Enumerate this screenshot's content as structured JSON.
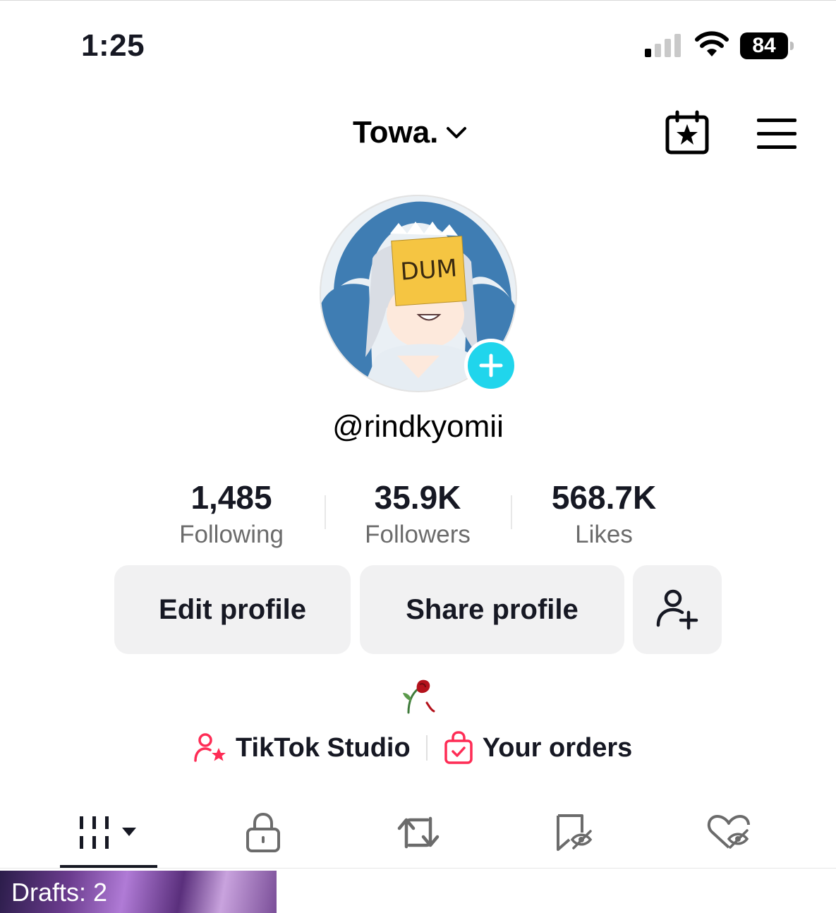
{
  "status_bar": {
    "time": "1:25",
    "battery": "84",
    "signal_icon": "cellular-signal-icon",
    "wifi_icon": "wifi-icon"
  },
  "header": {
    "account_name": "Towa.",
    "switch_icon": "chevron-down-icon",
    "calendar_icon": "calendar-star-icon",
    "menu_icon": "hamburger-menu-icon"
  },
  "profile": {
    "avatar_label": "DUM",
    "username": "@rindkyomii",
    "stats": [
      {
        "value": "1,485",
        "label": "Following"
      },
      {
        "value": "35.9K",
        "label": "Followers"
      },
      {
        "value": "568.7K",
        "label": "Likes"
      }
    ],
    "bio": "🥀"
  },
  "actions": {
    "edit_profile": "Edit profile",
    "share_profile": "Share profile",
    "add_friend_icon": "add-user-icon"
  },
  "links": {
    "studio": "TikTok Studio",
    "orders": "Your orders"
  },
  "tabs": [
    {
      "icon": "videos-grid-icon",
      "active": true
    },
    {
      "icon": "lock-icon",
      "active": false
    },
    {
      "icon": "repost-icon",
      "active": false
    },
    {
      "icon": "favorites-hidden-icon",
      "active": false
    },
    {
      "icon": "liked-hidden-icon",
      "active": false
    }
  ],
  "grid": {
    "drafts_label": "Drafts: 2"
  },
  "colors": {
    "accent": "#fe2c55",
    "add_badge": "#20d5ec",
    "button_bg": "#f1f1f2",
    "text": "#161823",
    "muted": "#6b6b6b"
  }
}
